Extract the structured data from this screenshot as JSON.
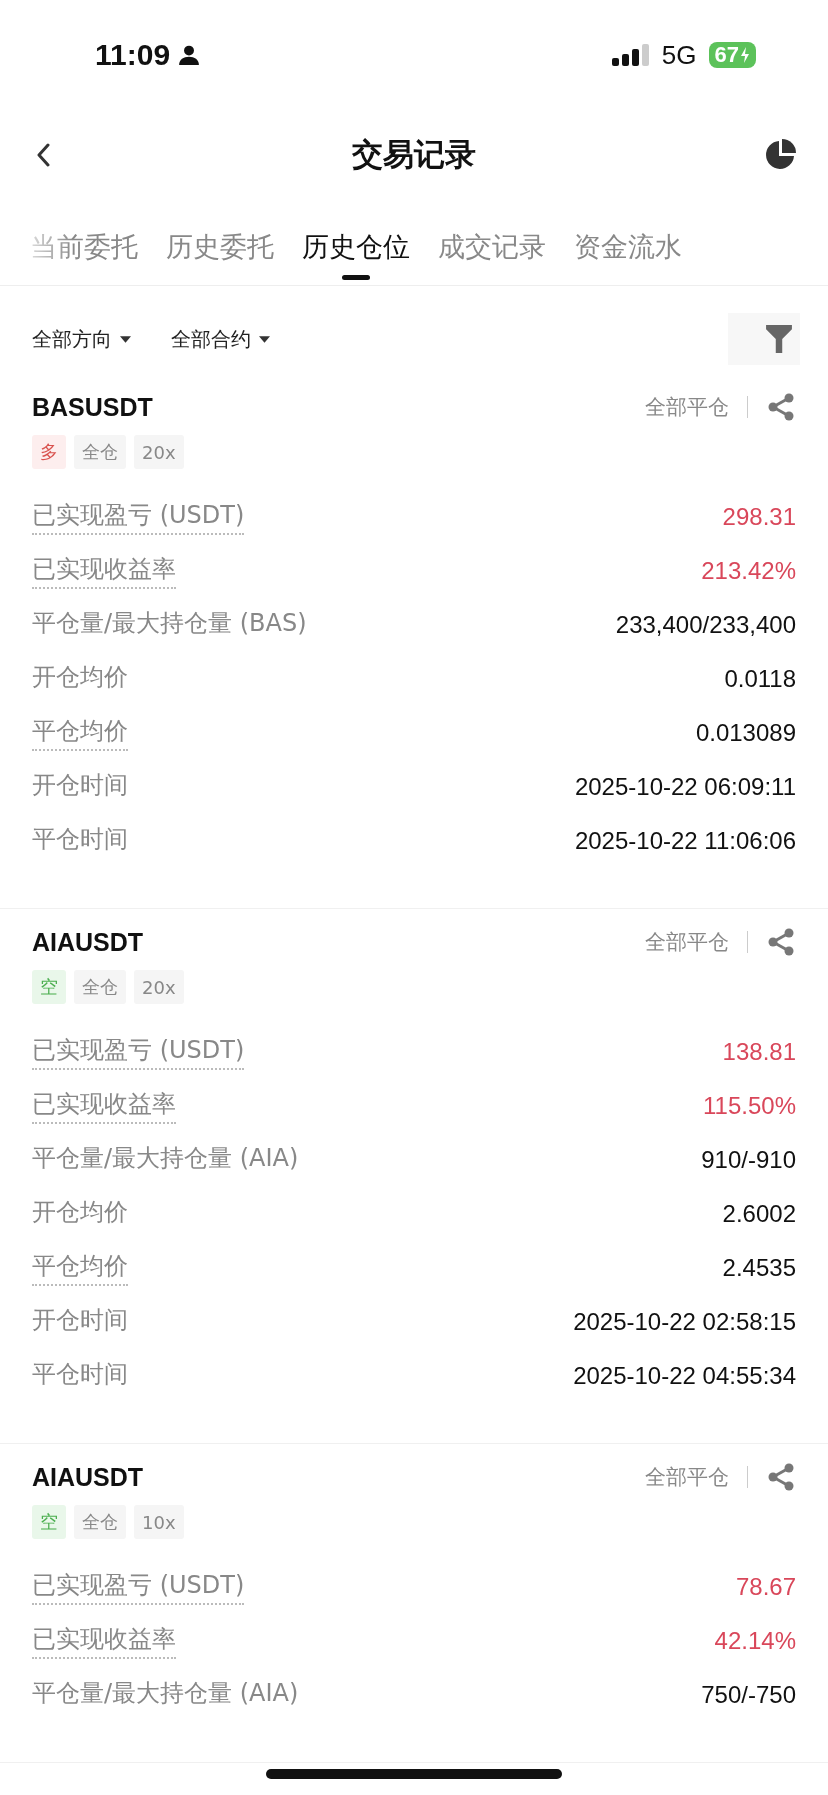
{
  "status_bar": {
    "time": "11:09",
    "network": "5G",
    "battery": "67"
  },
  "nav": {
    "title": "交易记录"
  },
  "tabs": [
    {
      "label": "当前委托",
      "selected": false
    },
    {
      "label": "历史委托",
      "selected": false
    },
    {
      "label": "历史仓位",
      "selected": true
    },
    {
      "label": "成交记录",
      "selected": false
    },
    {
      "label": "资金流水",
      "selected": false
    }
  ],
  "filters": [
    "全部方向",
    "全部合约"
  ],
  "positions": [
    {
      "symbol": "BASUSDT",
      "action": "全部平仓",
      "tags": [
        {
          "label": "多",
          "kind": "long"
        },
        {
          "label": "全仓",
          "kind": "plain"
        },
        {
          "label": "20x",
          "kind": "plain"
        }
      ],
      "rows": [
        {
          "label": "已实现盈亏 (USDT)",
          "value": "298.31",
          "dotted": true,
          "profit": true
        },
        {
          "label": "已实现收益率",
          "value": "213.42%",
          "dotted": true,
          "profit": true
        },
        {
          "label": "平仓量/最大持仓量 (BAS)",
          "value": "233,400/233,400",
          "dotted": false,
          "profit": false
        },
        {
          "label": "开仓均价",
          "value": "0.0118",
          "dotted": false,
          "profit": false
        },
        {
          "label": "平仓均价",
          "value": "0.013089",
          "dotted": true,
          "profit": false
        },
        {
          "label": "开仓时间",
          "value": "2025-10-22 06:09:11",
          "dotted": false,
          "profit": false
        },
        {
          "label": "平仓时间",
          "value": "2025-10-22 11:06:06",
          "dotted": false,
          "profit": false
        }
      ]
    },
    {
      "symbol": "AIAUSDT",
      "action": "全部平仓",
      "tags": [
        {
          "label": "空",
          "kind": "short"
        },
        {
          "label": "全仓",
          "kind": "plain"
        },
        {
          "label": "20x",
          "kind": "plain"
        }
      ],
      "rows": [
        {
          "label": "已实现盈亏 (USDT)",
          "value": "138.81",
          "dotted": true,
          "profit": true
        },
        {
          "label": "已实现收益率",
          "value": "115.50%",
          "dotted": true,
          "profit": true
        },
        {
          "label": "平仓量/最大持仓量 (AIA)",
          "value": "910/-910",
          "dotted": false,
          "profit": false
        },
        {
          "label": "开仓均价",
          "value": "2.6002",
          "dotted": false,
          "profit": false
        },
        {
          "label": "平仓均价",
          "value": "2.4535",
          "dotted": true,
          "profit": false
        },
        {
          "label": "开仓时间",
          "value": "2025-10-22 02:58:15",
          "dotted": false,
          "profit": false
        },
        {
          "label": "平仓时间",
          "value": "2025-10-22 04:55:34",
          "dotted": false,
          "profit": false
        }
      ]
    },
    {
      "symbol": "AIAUSDT",
      "action": "全部平仓",
      "tags": [
        {
          "label": "空",
          "kind": "short"
        },
        {
          "label": "全仓",
          "kind": "plain"
        },
        {
          "label": "10x",
          "kind": "plain"
        }
      ],
      "rows": [
        {
          "label": "已实现盈亏 (USDT)",
          "value": "78.67",
          "dotted": true,
          "profit": true
        },
        {
          "label": "已实现收益率",
          "value": "42.14%",
          "dotted": true,
          "profit": true
        },
        {
          "label": "平仓量/最大持仓量 (AIA)",
          "value": "750/-750",
          "dotted": false,
          "profit": false
        }
      ]
    }
  ]
}
